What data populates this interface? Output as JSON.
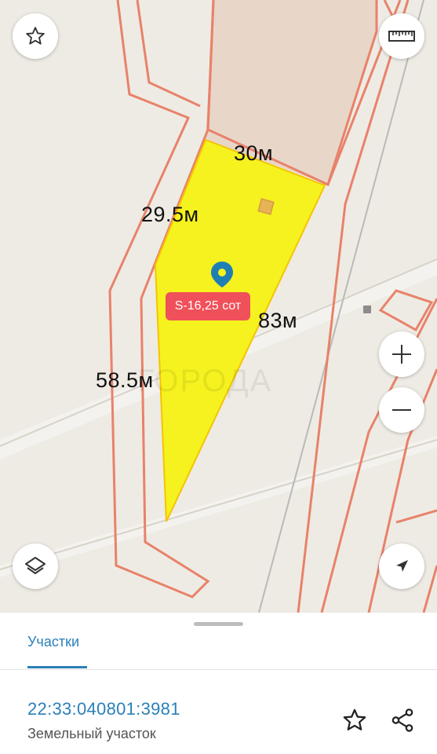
{
  "map": {
    "dimensions": {
      "top": "30м",
      "left_upper": "29.5м",
      "right": "83м",
      "left_lower": "58.5м"
    },
    "area_label": "S-16,25 сот",
    "watermark": "ГОРОДА",
    "colors": {
      "background": "#eeebe4",
      "parcel_fill": "#f5f21f",
      "parcel_stroke": "#f5c400",
      "boundary": "#e8826a",
      "building": "#e8d6c8",
      "pin": "#1f7fb5",
      "badge": "#f0505a"
    },
    "controls": {
      "favorite_icon": "star-outline-icon",
      "ruler_icon": "ruler-icon",
      "zoom_in_icon": "plus-icon",
      "zoom_out_icon": "minus-icon",
      "layers_icon": "layers-icon",
      "locate_icon": "navigation-arrow-icon"
    }
  },
  "sheet": {
    "tab_label": "Участки",
    "parcel_id": "22:33:040801:3981",
    "parcel_type": "Земельный участок",
    "actions": {
      "favorite_icon": "star-outline-icon",
      "share_icon": "share-icon"
    }
  }
}
